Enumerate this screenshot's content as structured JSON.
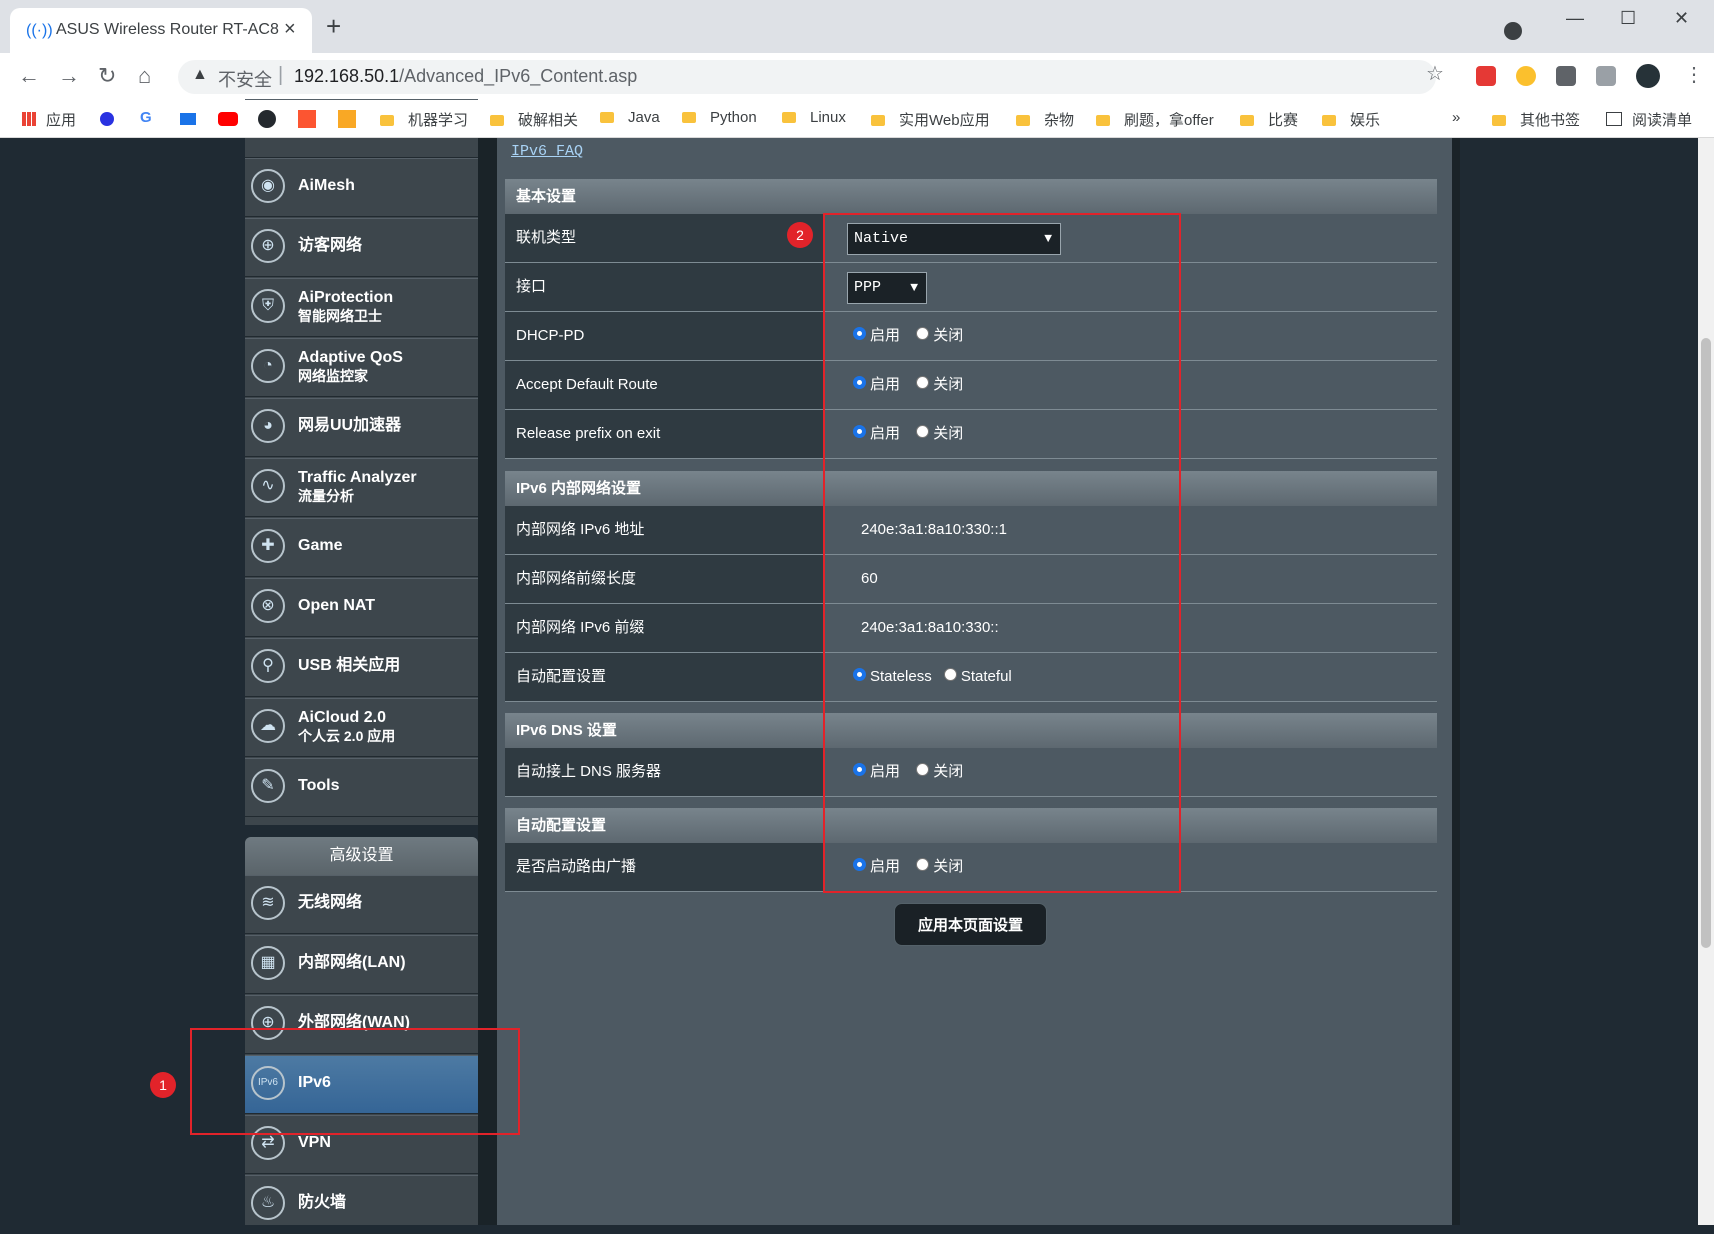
{
  "browser": {
    "tab_title": "ASUS Wireless Router RT-AC8",
    "insecure_label": "不安全",
    "url_host": "192.168.50.1",
    "url_path": "/Advanced_IPv6_Content.asp",
    "bookmarks": [
      "应用",
      "机器学习",
      "破解相关",
      "Java",
      "Python",
      "Linux",
      "实用Web应用",
      "杂物",
      "刷题，拿offer",
      "比赛",
      "娱乐",
      "»",
      "其他书签",
      "阅读清单"
    ]
  },
  "sidebar": {
    "items": [
      {
        "label": "AiMesh",
        "icon": "aimesh-icon"
      },
      {
        "label": "访客网络",
        "icon": "guest-network-icon"
      },
      {
        "label": "AiProtection",
        "sub": "智能网络卫士",
        "icon": "shield-lock-icon"
      },
      {
        "label": "Adaptive QoS",
        "sub": "网络监控家",
        "icon": "speedometer-icon"
      },
      {
        "label": "网易UU加速器",
        "icon": "gauge-icon"
      },
      {
        "label": "Traffic Analyzer",
        "sub": "流量分析",
        "icon": "traffic-icon"
      },
      {
        "label": "Game",
        "icon": "gamepad-icon"
      },
      {
        "label": "Open NAT",
        "icon": "globe-nat-icon"
      },
      {
        "label": "USB 相关应用",
        "icon": "usb-icon"
      },
      {
        "label": "AiCloud 2.0",
        "sub": "个人云 2.0 应用",
        "icon": "cloud-icon"
      },
      {
        "label": "Tools",
        "icon": "wrench-icon"
      }
    ],
    "advanced_header": "高级设置",
    "advanced_items": [
      {
        "label": "无线网络",
        "icon": "wireless-icon"
      },
      {
        "label": "内部网络(LAN)",
        "icon": "lan-icon"
      },
      {
        "label": "外部网络(WAN)",
        "icon": "wan-globe-icon"
      },
      {
        "label": "IPv6",
        "icon": "ipv6-globe-icon"
      },
      {
        "label": "VPN",
        "icon": "vpn-icon"
      },
      {
        "label": "防火墙",
        "icon": "firewall-icon"
      }
    ]
  },
  "content": {
    "faq_link": "IPv6 FAQ",
    "sections": {
      "basic": "基本设置",
      "lan": "IPv6 内部网络设置",
      "dns": "IPv6 DNS 设置",
      "auto": "自动配置设置"
    },
    "rows": {
      "conn_type": {
        "label": "联机类型",
        "value": "Native"
      },
      "interface": {
        "label": "接口",
        "value": "PPP"
      },
      "dhcp_pd": {
        "label": "DHCP-PD"
      },
      "accept_route": {
        "label": "Accept Default Route"
      },
      "release_prefix": {
        "label": "Release prefix on exit"
      },
      "lan_addr": {
        "label": "内部网络 IPv6 地址",
        "value": "240e:3a1:8a10:330::1"
      },
      "prefix_len": {
        "label": "内部网络前缀长度",
        "value": "60"
      },
      "lan_prefix": {
        "label": "内部网络 IPv6 前缀",
        "value": "240e:3a1:8a10:330::"
      },
      "autoconf": {
        "label": "自动配置设置",
        "opt1": "Stateless",
        "opt2": "Stateful"
      },
      "auto_dns": {
        "label": "自动接上 DNS 服务器"
      },
      "router_adv": {
        "label": "是否启动路由广播"
      }
    },
    "enable": "启用",
    "disable": "关闭",
    "apply_button": "应用本页面设置"
  },
  "annotations": {
    "one": "1",
    "two": "2"
  },
  "colors": {
    "accent": "#1a73e8",
    "highlight": "#e2232a",
    "panel": "#4d5962"
  }
}
